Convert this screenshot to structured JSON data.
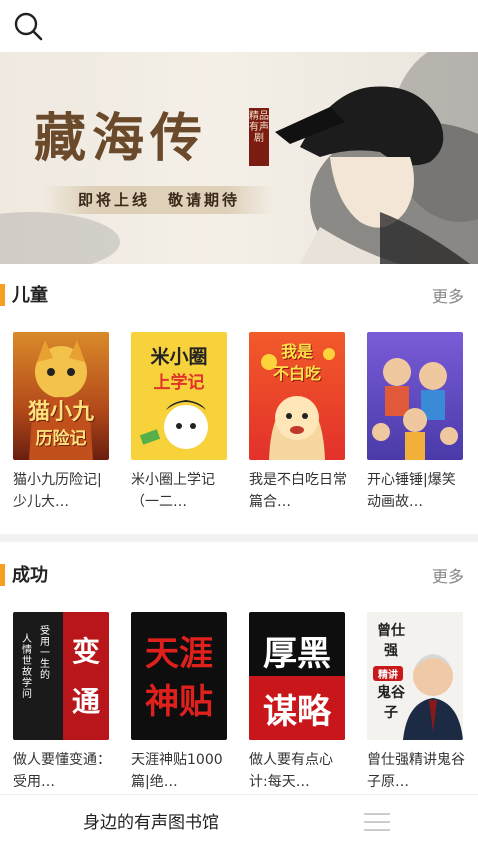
{
  "header": {
    "search_icon": "search-icon"
  },
  "banner": {
    "title": "藏海传",
    "seal": "精品有声剧",
    "subtitle": "即将上线　敬请期待"
  },
  "colors": {
    "accent": "#f5a020",
    "more": "#888888",
    "divider": "#f2f2f2"
  },
  "sections": [
    {
      "title": "儿童",
      "more": "更多",
      "books": [
        {
          "title": "猫小九历险记|少儿大…",
          "cover_text": [
            "猫小九",
            "历险记"
          ]
        },
        {
          "title": "米小圈上学记（一二…",
          "cover_text": [
            "米小圈",
            "上学记"
          ]
        },
        {
          "title": "我是不白吃日常篇合…",
          "cover_text": [
            "我是",
            "不白吃"
          ]
        },
        {
          "title": "开心锤锤|爆笑动画故…",
          "cover_text": []
        }
      ]
    },
    {
      "title": "成功",
      "more": "更多",
      "books": [
        {
          "title": "做人要懂变通：受用…",
          "cover_text": [
            "变",
            "通",
            "受用一生的",
            "人情世故学问"
          ]
        },
        {
          "title": "天涯神贴1000篇|绝…",
          "cover_text": [
            "天涯",
            "神贴"
          ]
        },
        {
          "title": "做人要有点心计:每天…",
          "cover_text": [
            "厚黑",
            "谋略"
          ]
        },
        {
          "title": "曾仕强精讲鬼谷子原…",
          "cover_text": [
            "曾仕强",
            "精讲",
            "鬼谷子"
          ]
        }
      ]
    }
  ],
  "bottom_bar": {
    "label": "身边的有声图书馆",
    "menu_icon": "menu-icon"
  }
}
